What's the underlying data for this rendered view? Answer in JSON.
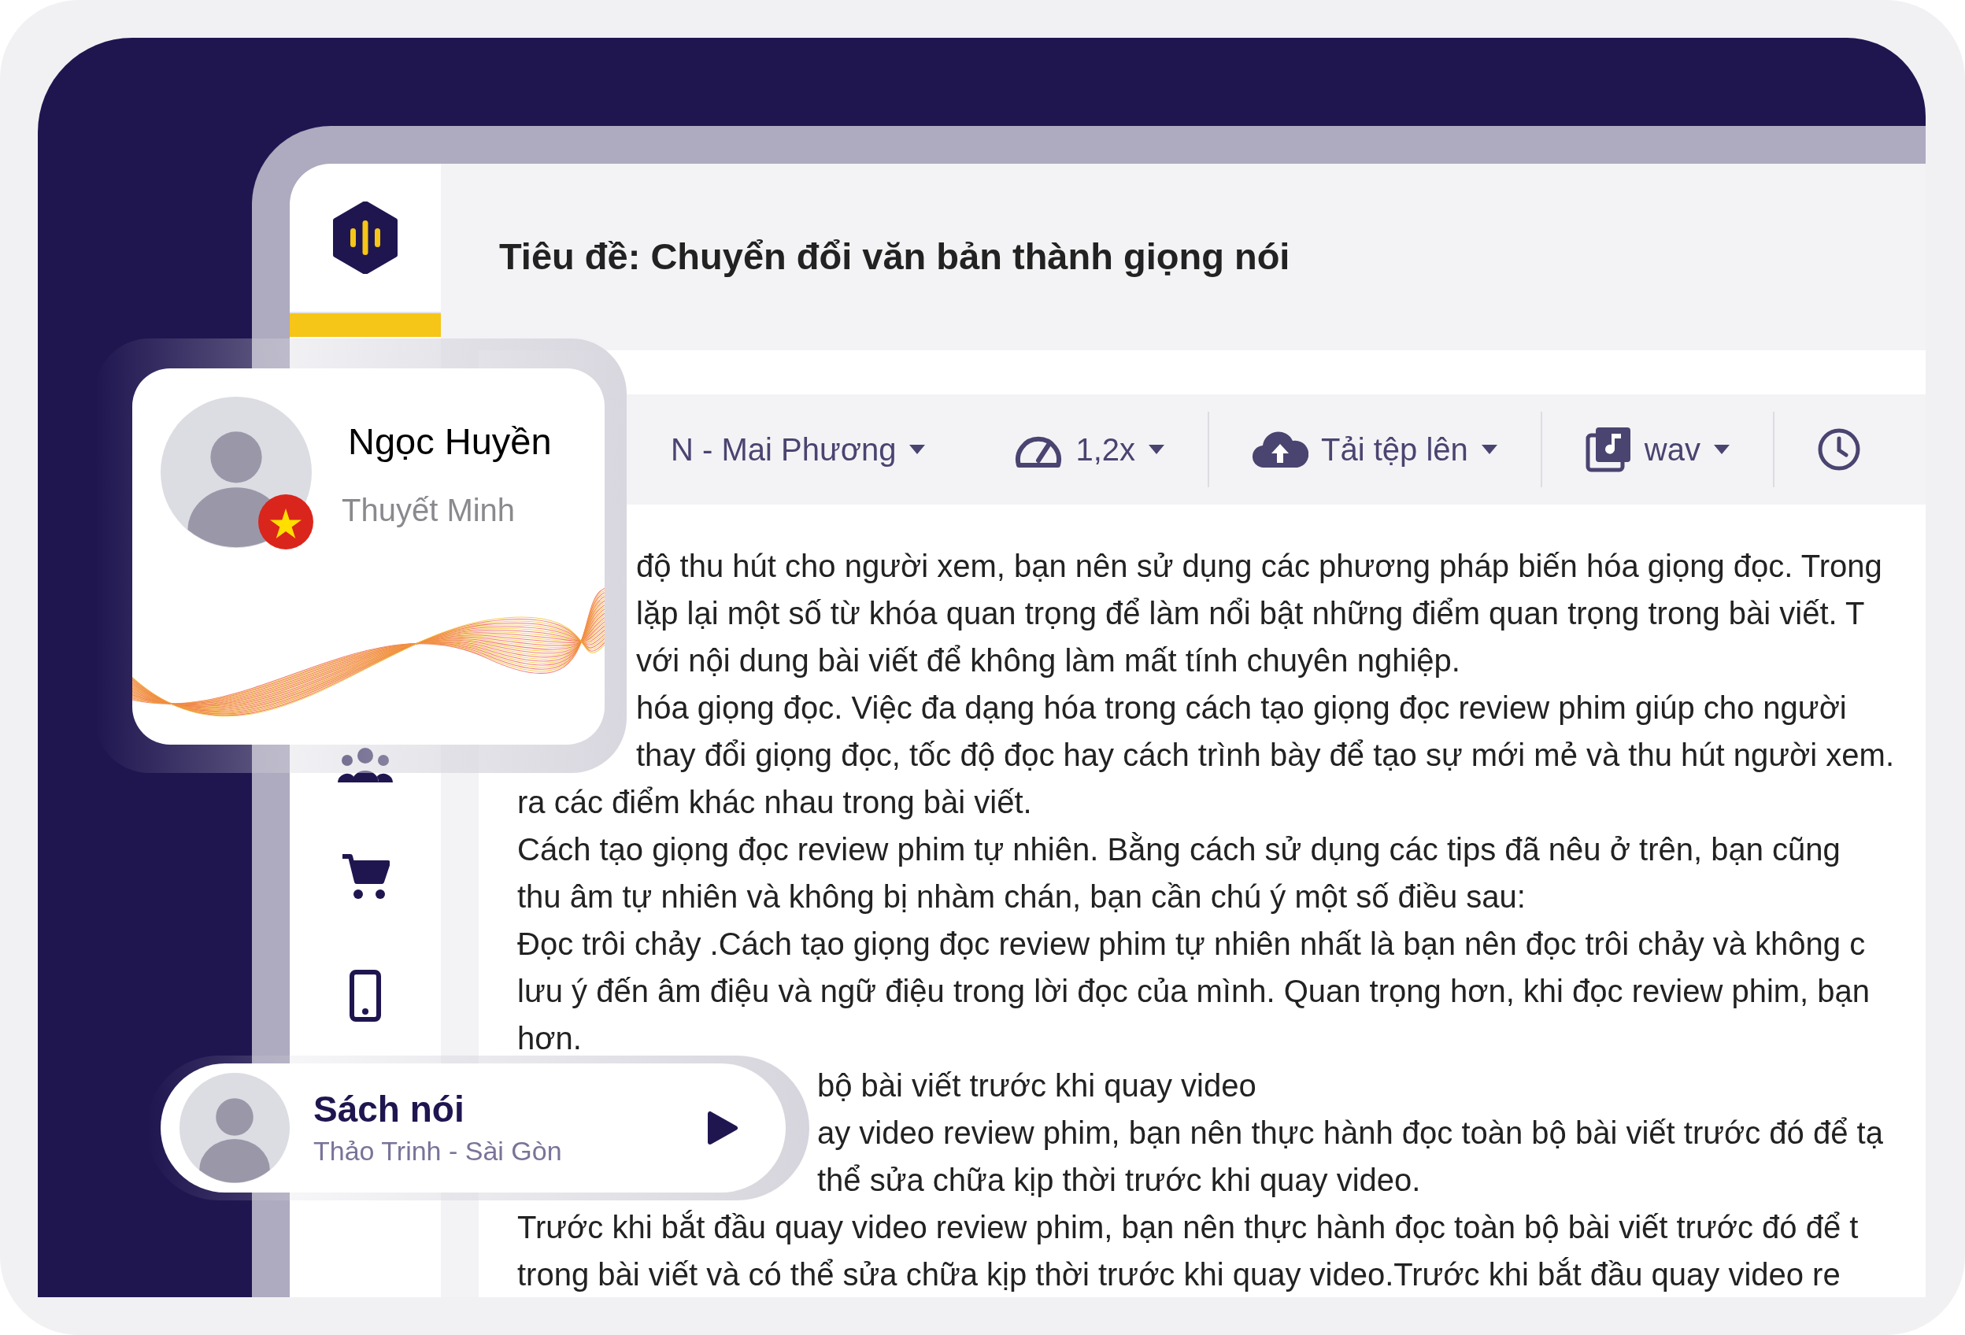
{
  "title": "Tiêu đề: Chuyển đổi văn bản thành giọng nói",
  "toolbar": [
    {
      "kind": "voice",
      "label": "N - Mai Phương"
    },
    {
      "kind": "speed",
      "label": "1,2x"
    },
    {
      "kind": "upload",
      "label": "Tải tệp lên"
    },
    {
      "kind": "format",
      "label": "wav"
    },
    {
      "kind": "history"
    }
  ],
  "text_lines": [
    {
      "kind": "after_profile_card",
      "text": "độ thu hút cho người xem, bạn nên sử dụng các phương pháp biến hóa giọng đọc. Trong"
    },
    {
      "kind": "after_profile_card",
      "text": "lặp lại một số từ khóa quan trọng để làm nổi bật những điểm quan trọng trong bài viết. T"
    },
    {
      "kind": "after_profile_card",
      "text": "với nội dung bài viết để không làm mất tính chuyên nghiệp."
    },
    {
      "kind": "after_profile_card",
      "text": "hóa giọng đọc. Việc đa dạng hóa trong cách tạo giọng đọc review phim giúp cho người"
    },
    {
      "kind": "after_profile_card",
      "text": "thay đổi giọng đọc, tốc độ đọc hay cách trình bày để tạo sự mới mẻ và thu hút người xem."
    },
    {
      "kind": "full",
      "text": "ra các điểm khác nhau trong bài viết."
    },
    {
      "kind": "full",
      "text": "Cách tạo giọng đọc review phim tự nhiên. Bằng cách sử dụng các tips đã nêu ở trên, bạn cũng"
    },
    {
      "kind": "full",
      "text": "thu âm tự nhiên và không bị nhàm chán, bạn cần chú ý một số điều sau:"
    },
    {
      "kind": "full",
      "text": "Đọc trôi chảy .Cách tạo giọng đọc review phim tự nhiên nhất là bạn nên đọc trôi chảy và không c"
    },
    {
      "kind": "full",
      "text": "lưu ý đến âm điệu và ngữ điệu trong lời đọc của mình. Quan trọng hơn, khi đọc review phim, bạn"
    },
    {
      "kind": "full",
      "text": "hơn."
    },
    {
      "kind": "after_player_card",
      "text": "bộ bài viết trước khi quay video"
    },
    {
      "kind": "after_player_card",
      "text": "ay video review phim, bạn nên thực hành đọc toàn bộ bài viết trước đó để tạ"
    },
    {
      "kind": "after_player_card",
      "text": "thể sửa chữa kịp thời trước khi quay video."
    },
    {
      "kind": "full",
      "text": "Trước khi bắt đầu quay video review phim, bạn nên thực hành đọc toàn bộ bài viết trước đó để t"
    },
    {
      "kind": "full",
      "text": "trong bài viết và có thể sửa chữa kịp thời trước khi quay video.Trước khi bắt đầu quay video re"
    }
  ],
  "profile_card": {
    "name": "Ngọc Huyền",
    "role": "Thuyết Minh"
  },
  "player_card": {
    "title": "Sách nói",
    "subtitle": "Thảo Trinh - Sài Gòn"
  }
}
